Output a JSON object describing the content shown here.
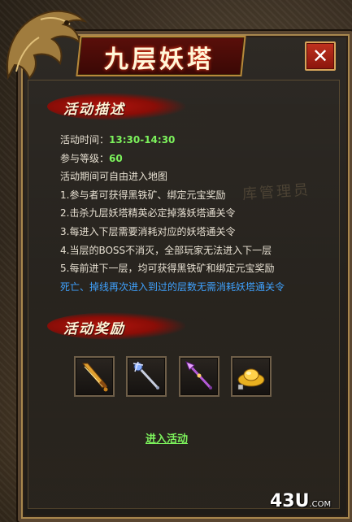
{
  "window": {
    "title": "九层妖塔",
    "close_label": "✕"
  },
  "sections": {
    "description_title": "活动描述",
    "rewards_title": "活动奖励"
  },
  "description": {
    "time_label": "活动时间：",
    "time_value": "13:30-14:30",
    "level_label": "参与等级：",
    "level_value": "60",
    "lines": [
      "活动期间可自由进入地图",
      "1.参与者可获得黑铁矿、绑定元宝奖励",
      "2.击杀九层妖塔精英必定掉落妖塔通关令",
      "3.每进入下层需要消耗对应的妖塔通关令",
      "4.当层的BOSS不消灭，全部玩家无法进入下一层",
      "5.每前进下一层，均可获得黑铁矿和绑定元宝奖励"
    ],
    "notice": "死亡、掉线再次进入到过的层数无需消耗妖塔通关令"
  },
  "rewards": [
    {
      "icon": "golden-sword-icon"
    },
    {
      "icon": "silver-staff-icon"
    },
    {
      "icon": "purple-spear-icon"
    },
    {
      "icon": "gold-ingot-icon"
    }
  ],
  "action": {
    "enter_label": "进入活动"
  },
  "watermark": "库管理员",
  "logo": {
    "main": "43U",
    "suffix": ".COM"
  },
  "colors": {
    "accent_green": "#7cf25c",
    "notice_blue": "#3fa2ff",
    "title_red": "#5a0f0a",
    "frame_gold": "#a8874e"
  }
}
